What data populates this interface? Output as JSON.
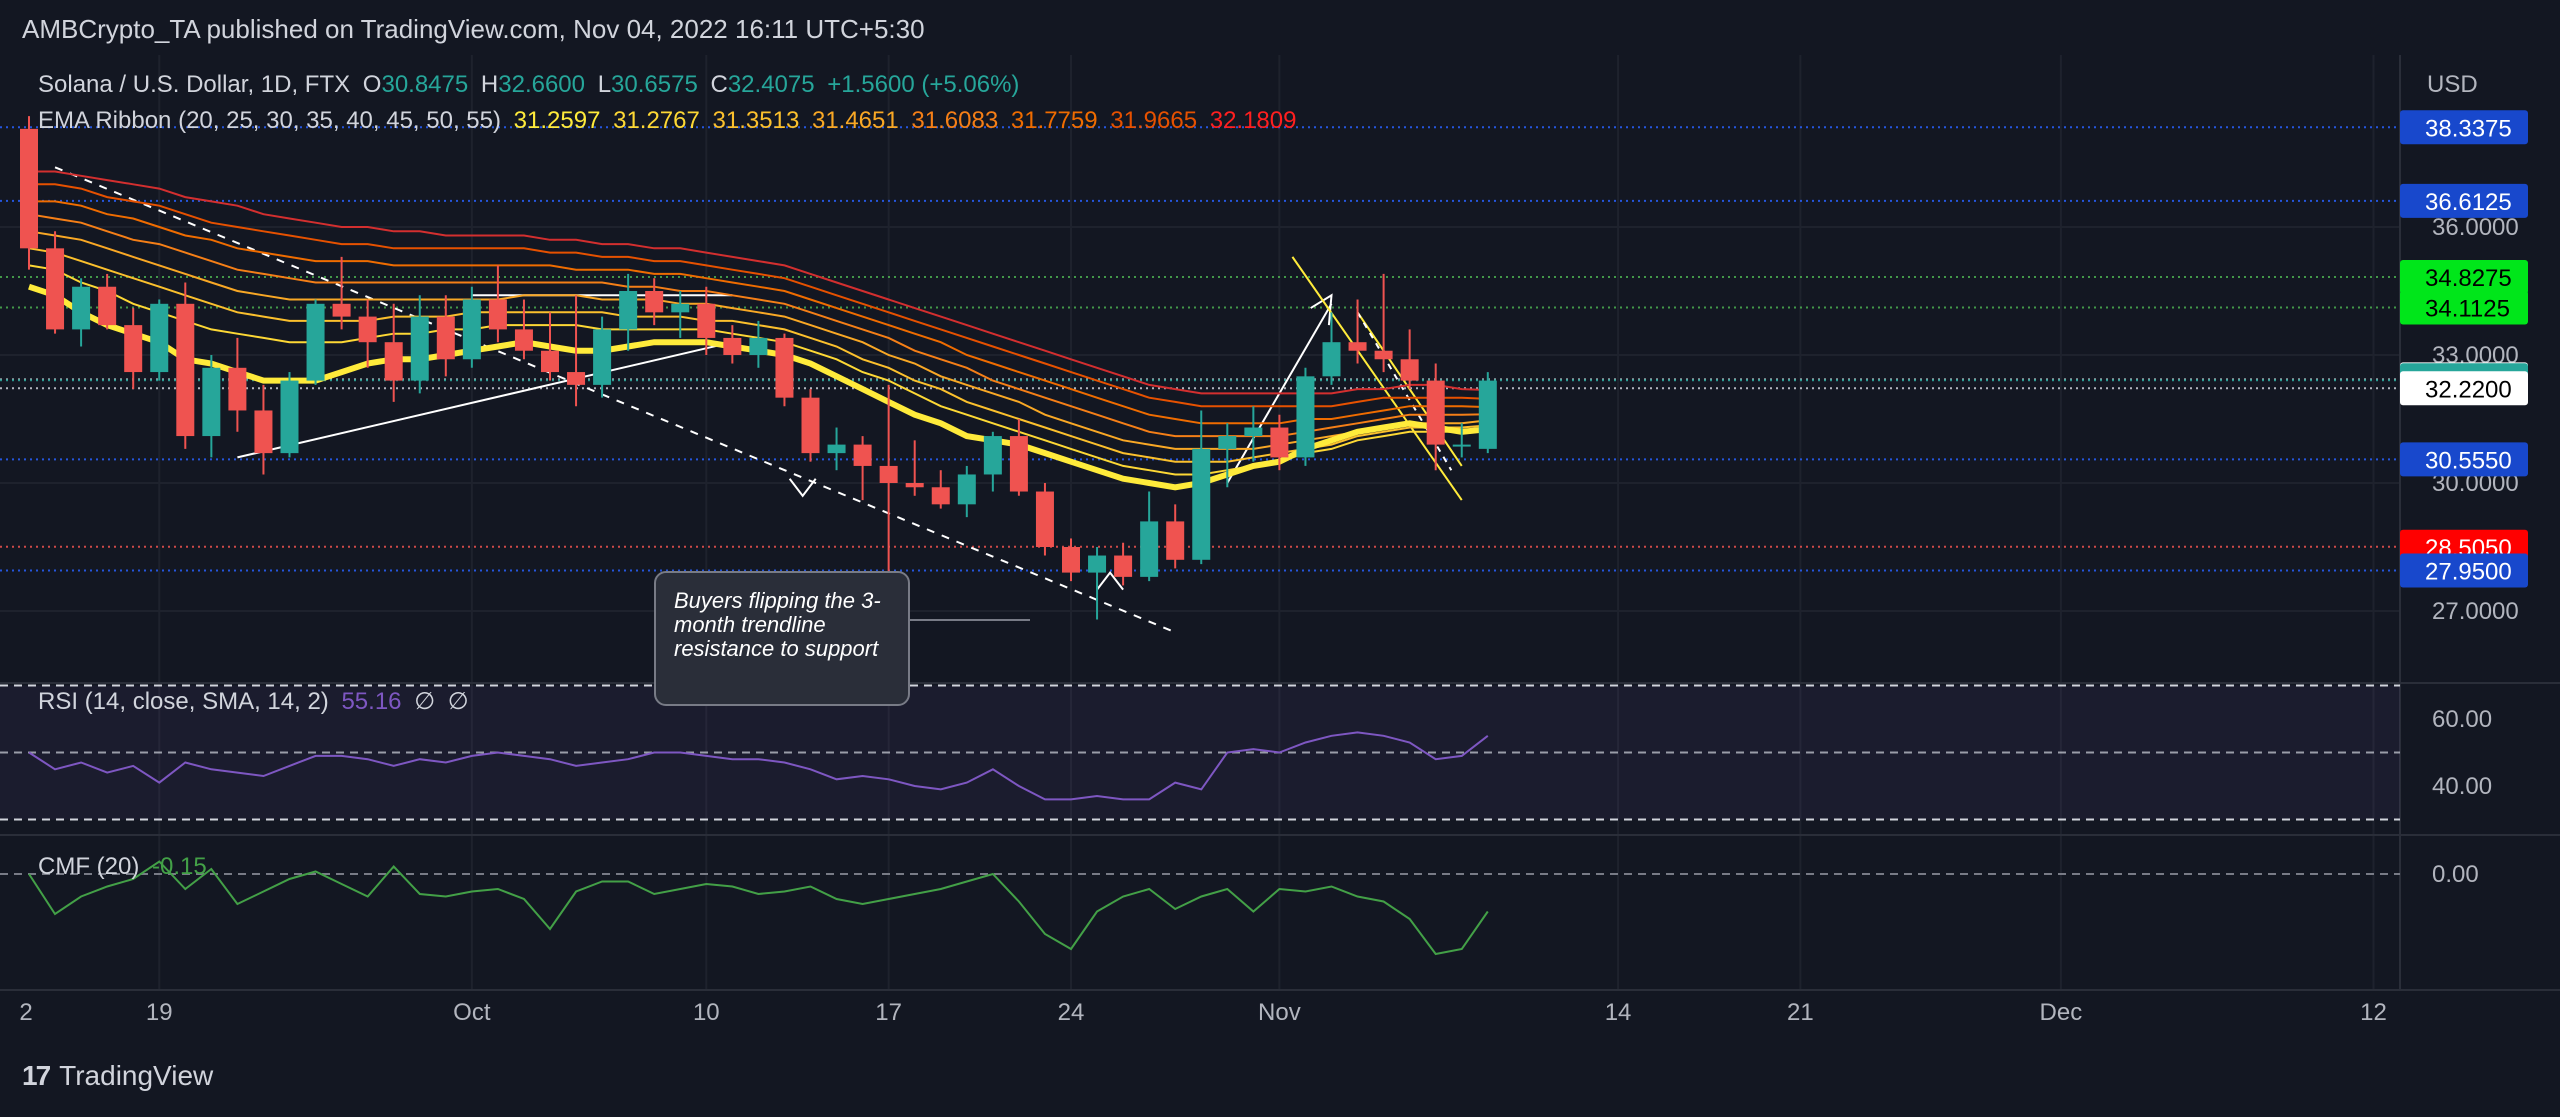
{
  "header": {
    "publisher_line": "AMBCrypto_TA published on TradingView.com, Nov 04, 2022 16:11 UTC+5:30"
  },
  "footer": {
    "brand": "TradingView",
    "logo": "17"
  },
  "legend": {
    "symbol": "Solana / U.S. Dollar, 1D, FTX",
    "o_label": "O",
    "o": "30.8475",
    "h_label": "H",
    "h": "32.6600",
    "l_label": "L",
    "l": "30.6575",
    "c_label": "C",
    "c": "32.4075",
    "change": "+1.5600 (+5.06%)",
    "ema_title": "EMA Ribbon (20, 25, 30, 35, 40, 45, 50, 55)",
    "ema_values": [
      "31.2597",
      "31.2767",
      "31.3513",
      "31.4651",
      "31.6083",
      "31.7759",
      "31.9665",
      "32.1809"
    ],
    "rsi_title": "RSI (14, close, SMA, 14, 2)",
    "rsi_value": "55.16",
    "rsi_extra1": "∅",
    "rsi_extra2": "∅",
    "cmf_title": "CMF (20)",
    "cmf_value": "-0.15"
  },
  "annotation": {
    "text": "Buyers flipping the 3-month trendline resistance to support"
  },
  "colors": {
    "up": "#26a69a",
    "down": "#ef5350",
    "ema": [
      "#ffeb3b",
      "#fdd835",
      "#fbc02d",
      "#f9a825",
      "#f57f17",
      "#ef6c00",
      "#e65100",
      "#d32f2f"
    ],
    "rsi": "#7e57c2",
    "cmf": "#43a047"
  },
  "chart_data": {
    "type": "candlestick",
    "price_axis": {
      "currency": "USD",
      "ticks": [
        "36.0000",
        "33.0000",
        "30.0000",
        "27.0000"
      ],
      "tick_values": [
        36,
        33,
        30,
        27
      ]
    },
    "x_axis": {
      "tick_labels": [
        "2",
        "19",
        "Oct",
        "10",
        "17",
        "24",
        "Nov",
        "14",
        "21",
        "Dec",
        "12"
      ],
      "tick_day_index": [
        -12,
        5,
        17,
        26,
        33,
        40,
        48,
        61,
        68,
        78,
        90
      ]
    },
    "horizontal_levels": [
      {
        "label": "38.3375",
        "value": 38.3375,
        "color": "#1848cc",
        "text_color": "#ffffff",
        "line": "#2962ff"
      },
      {
        "label": "36.6125",
        "value": 36.6125,
        "color": "#1848cc",
        "text_color": "#ffffff",
        "line": "#2962ff"
      },
      {
        "label": "34.8275",
        "value": 34.8275,
        "color": "#00e61a",
        "text_color": "#000000",
        "line": "#4caf50"
      },
      {
        "label": "34.1125",
        "value": 34.1125,
        "color": "#00e61a",
        "text_color": "#000000",
        "line": "#4caf50"
      },
      {
        "label": "32.4275",
        "value": 32.4275,
        "color": "#ffffff",
        "text_color": "#000000",
        "line": "#d1d4dc"
      },
      {
        "label": "32.4075",
        "value": 32.4075,
        "color": "#26a69a",
        "text_color": "#ffffff",
        "line": "#26a69a"
      },
      {
        "label": "32.2200",
        "value": 32.22,
        "color": "#ffffff",
        "text_color": "#000000",
        "line": "#d1d4dc"
      },
      {
        "label": "30.5550",
        "value": 30.555,
        "color": "#1848cc",
        "text_color": "#ffffff",
        "line": "#2962ff"
      },
      {
        "label": "28.5050",
        "value": 28.505,
        "color": "#ff0000",
        "text_color": "#ffffff",
        "line": "#ef5350"
      },
      {
        "label": "27.9500",
        "value": 27.95,
        "color": "#1848cc",
        "text_color": "#ffffff",
        "line": "#2962ff"
      }
    ],
    "candles": [
      [
        38.3,
        38.6,
        35.0,
        35.5
      ],
      [
        35.5,
        35.9,
        33.5,
        33.6
      ],
      [
        33.6,
        34.8,
        33.2,
        34.6
      ],
      [
        34.6,
        34.9,
        33.6,
        33.7
      ],
      [
        33.7,
        34.1,
        32.2,
        32.6
      ],
      [
        32.6,
        34.3,
        32.4,
        34.2
      ],
      [
        34.2,
        34.7,
        30.8,
        31.1
      ],
      [
        31.1,
        33.0,
        30.6,
        32.7
      ],
      [
        32.7,
        33.4,
        31.2,
        31.7
      ],
      [
        31.7,
        32.3,
        30.2,
        30.7
      ],
      [
        30.7,
        32.6,
        30.6,
        32.4
      ],
      [
        32.4,
        34.3,
        32.3,
        34.2
      ],
      [
        34.2,
        35.3,
        33.6,
        33.9
      ],
      [
        33.9,
        34.3,
        32.7,
        33.3
      ],
      [
        33.3,
        34.2,
        31.9,
        32.4
      ],
      [
        32.4,
        34.4,
        32.1,
        33.9
      ],
      [
        33.9,
        34.4,
        32.5,
        32.9
      ],
      [
        32.9,
        34.6,
        32.7,
        34.3
      ],
      [
        34.3,
        35.1,
        33.3,
        33.6
      ],
      [
        33.6,
        34.3,
        32.9,
        33.1
      ],
      [
        33.1,
        34.0,
        32.4,
        32.6
      ],
      [
        32.6,
        34.4,
        31.8,
        32.3
      ],
      [
        32.3,
        33.9,
        32.0,
        33.6
      ],
      [
        33.6,
        34.9,
        33.1,
        34.5
      ],
      [
        34.5,
        34.8,
        33.7,
        34.0
      ],
      [
        34.0,
        34.5,
        33.4,
        34.2
      ],
      [
        34.2,
        34.6,
        33.0,
        33.4
      ],
      [
        33.4,
        33.7,
        32.8,
        33.0
      ],
      [
        33.0,
        33.8,
        32.7,
        33.4
      ],
      [
        33.4,
        33.5,
        31.8,
        32.0
      ],
      [
        32.0,
        32.2,
        30.5,
        30.7
      ],
      [
        30.7,
        31.3,
        30.3,
        30.9
      ],
      [
        30.9,
        31.1,
        29.6,
        30.4
      ],
      [
        30.4,
        32.3,
        27.4,
        30.0
      ],
      [
        30.0,
        31.0,
        29.7,
        29.9
      ],
      [
        29.9,
        30.3,
        29.4,
        29.5
      ],
      [
        29.5,
        30.4,
        29.2,
        30.2
      ],
      [
        30.2,
        31.2,
        29.8,
        31.1
      ],
      [
        31.1,
        31.5,
        29.7,
        29.8
      ],
      [
        29.8,
        30.0,
        28.3,
        28.5
      ],
      [
        28.5,
        28.7,
        27.7,
        27.9
      ],
      [
        27.9,
        28.5,
        26.8,
        28.3
      ],
      [
        28.3,
        28.6,
        27.6,
        27.8
      ],
      [
        27.8,
        29.8,
        27.7,
        29.1
      ],
      [
        29.1,
        29.5,
        28.0,
        28.2
      ],
      [
        28.2,
        31.7,
        28.1,
        30.8
      ],
      [
        30.8,
        31.4,
        29.9,
        31.1
      ],
      [
        31.1,
        31.8,
        30.5,
        31.3
      ],
      [
        31.3,
        31.6,
        30.3,
        30.6
      ],
      [
        30.6,
        32.7,
        30.4,
        32.5
      ],
      [
        32.5,
        34.0,
        32.3,
        33.3
      ],
      [
        33.3,
        34.3,
        32.8,
        33.1
      ],
      [
        33.1,
        34.9,
        32.6,
        32.9
      ],
      [
        32.9,
        33.6,
        32.2,
        32.4
      ],
      [
        32.4,
        32.8,
        30.3,
        30.9
      ],
      [
        30.9,
        31.4,
        30.6,
        30.9
      ],
      [
        30.8,
        32.6,
        30.7,
        32.4
      ]
    ],
    "ema_ribbon": [
      [
        34.6,
        34.4,
        34.0,
        33.7,
        33.5,
        33.3,
        32.9,
        32.8,
        32.6,
        32.4,
        32.4,
        32.4,
        32.6,
        32.8,
        32.9,
        32.9,
        33.0,
        33.1,
        33.2,
        33.3,
        33.2,
        33.1,
        33.1,
        33.2,
        33.3,
        33.3,
        33.3,
        33.2,
        33.1,
        33.0,
        32.8,
        32.5,
        32.2,
        31.9,
        31.6,
        31.4,
        31.1,
        31.0,
        30.9,
        30.7,
        30.5,
        30.3,
        30.1,
        30.0,
        29.9,
        30.0,
        30.2,
        30.4,
        30.5,
        30.8,
        31.0,
        31.2,
        31.3,
        31.4,
        31.3,
        31.2,
        31.26
      ],
      [
        35.1,
        35.0,
        34.7,
        34.5,
        34.2,
        34.0,
        33.8,
        33.6,
        33.5,
        33.4,
        33.3,
        33.3,
        33.3,
        33.4,
        33.5,
        33.5,
        33.6,
        33.6,
        33.7,
        33.7,
        33.7,
        33.7,
        33.6,
        33.6,
        33.6,
        33.6,
        33.6,
        33.5,
        33.4,
        33.3,
        33.1,
        32.9,
        32.6,
        32.4,
        32.1,
        31.8,
        31.6,
        31.4,
        31.2,
        31.0,
        30.8,
        30.6,
        30.4,
        30.3,
        30.2,
        30.2,
        30.3,
        30.4,
        30.5,
        30.7,
        30.8,
        31.0,
        31.1,
        31.2,
        31.2,
        31.2,
        31.28
      ],
      [
        35.5,
        35.4,
        35.2,
        35.0,
        34.8,
        34.6,
        34.4,
        34.2,
        34.0,
        33.9,
        33.8,
        33.8,
        33.8,
        33.8,
        33.9,
        33.9,
        33.9,
        34.0,
        34.0,
        34.0,
        34.0,
        34.0,
        34.0,
        33.9,
        33.9,
        33.9,
        33.8,
        33.8,
        33.7,
        33.6,
        33.4,
        33.2,
        32.9,
        32.7,
        32.4,
        32.2,
        31.9,
        31.7,
        31.5,
        31.3,
        31.1,
        30.9,
        30.7,
        30.6,
        30.5,
        30.5,
        30.5,
        30.6,
        30.7,
        30.8,
        30.9,
        31.1,
        31.2,
        31.3,
        31.3,
        31.3,
        31.35
      ],
      [
        35.9,
        35.8,
        35.7,
        35.5,
        35.3,
        35.1,
        34.9,
        34.7,
        34.5,
        34.4,
        34.3,
        34.3,
        34.3,
        34.3,
        34.3,
        34.3,
        34.3,
        34.3,
        34.3,
        34.4,
        34.4,
        34.4,
        34.3,
        34.3,
        34.3,
        34.2,
        34.2,
        34.1,
        34.0,
        33.9,
        33.7,
        33.5,
        33.3,
        33.0,
        32.8,
        32.5,
        32.3,
        32.1,
        31.9,
        31.6,
        31.4,
        31.2,
        31.0,
        30.9,
        30.8,
        30.8,
        30.8,
        30.8,
        30.9,
        31.0,
        31.1,
        31.2,
        31.3,
        31.4,
        31.4,
        31.4,
        31.47
      ],
      [
        36.3,
        36.2,
        36.1,
        35.9,
        35.7,
        35.6,
        35.4,
        35.2,
        35.0,
        34.9,
        34.8,
        34.7,
        34.7,
        34.7,
        34.7,
        34.7,
        34.7,
        34.7,
        34.7,
        34.7,
        34.7,
        34.7,
        34.7,
        34.6,
        34.6,
        34.5,
        34.5,
        34.4,
        34.3,
        34.2,
        34.0,
        33.8,
        33.6,
        33.4,
        33.1,
        32.9,
        32.7,
        32.4,
        32.2,
        32.0,
        31.8,
        31.6,
        31.4,
        31.2,
        31.1,
        31.1,
        31.1,
        31.1,
        31.1,
        31.2,
        31.3,
        31.4,
        31.5,
        31.6,
        31.6,
        31.6,
        31.61
      ],
      [
        36.6,
        36.6,
        36.5,
        36.3,
        36.2,
        36.0,
        35.8,
        35.7,
        35.5,
        35.4,
        35.3,
        35.2,
        35.2,
        35.2,
        35.1,
        35.1,
        35.1,
        35.1,
        35.1,
        35.1,
        35.1,
        35.0,
        35.0,
        35.0,
        34.9,
        34.9,
        34.8,
        34.7,
        34.6,
        34.5,
        34.3,
        34.1,
        33.9,
        33.7,
        33.5,
        33.3,
        33.0,
        32.8,
        32.6,
        32.4,
        32.2,
        32.0,
        31.8,
        31.6,
        31.5,
        31.4,
        31.4,
        31.4,
        31.4,
        31.5,
        31.5,
        31.6,
        31.7,
        31.8,
        31.8,
        31.8,
        31.78
      ],
      [
        37.0,
        37.0,
        36.9,
        36.7,
        36.6,
        36.5,
        36.3,
        36.1,
        36.0,
        35.9,
        35.8,
        35.7,
        35.6,
        35.6,
        35.5,
        35.5,
        35.5,
        35.5,
        35.5,
        35.5,
        35.4,
        35.4,
        35.3,
        35.3,
        35.2,
        35.2,
        35.1,
        35.0,
        34.9,
        34.8,
        34.6,
        34.4,
        34.2,
        34.0,
        33.8,
        33.6,
        33.4,
        33.2,
        33.0,
        32.8,
        32.6,
        32.4,
        32.2,
        32.0,
        31.9,
        31.8,
        31.8,
        31.8,
        31.8,
        31.8,
        31.8,
        31.9,
        32.0,
        32.0,
        32.0,
        32.0,
        31.97
      ],
      [
        37.3,
        37.3,
        37.2,
        37.1,
        37.0,
        36.9,
        36.7,
        36.6,
        36.5,
        36.3,
        36.2,
        36.1,
        36.0,
        36.0,
        35.9,
        35.9,
        35.8,
        35.8,
        35.8,
        35.8,
        35.7,
        35.7,
        35.6,
        35.6,
        35.5,
        35.5,
        35.4,
        35.3,
        35.2,
        35.1,
        34.9,
        34.7,
        34.5,
        34.3,
        34.1,
        33.9,
        33.7,
        33.5,
        33.3,
        33.1,
        32.9,
        32.7,
        32.5,
        32.3,
        32.2,
        32.1,
        32.1,
        32.1,
        32.1,
        32.1,
        32.1,
        32.2,
        32.2,
        32.3,
        32.3,
        32.2,
        32.18
      ]
    ],
    "rsi": {
      "ticks": [
        "60.00",
        "40.00"
      ],
      "tick_values": [
        60,
        40
      ],
      "values": [
        50,
        45,
        47,
        44,
        46,
        41,
        47,
        45,
        44,
        43,
        46,
        49,
        49,
        48,
        46,
        48,
        47,
        49,
        50,
        49,
        48,
        46,
        47,
        48,
        50,
        50,
        49,
        48,
        48,
        47,
        45,
        42,
        43,
        42,
        40,
        39,
        41,
        45,
        40,
        36,
        36,
        37,
        36,
        36,
        41,
        39,
        50,
        51,
        50,
        53,
        55,
        56,
        55,
        53,
        48,
        49,
        55
      ]
    },
    "cmf": {
      "ticks": [
        "0.00"
      ],
      "tick_values": [
        0
      ],
      "values": [
        0.0,
        -0.16,
        -0.09,
        -0.05,
        -0.02,
        0.05,
        -0.06,
        0.02,
        -0.12,
        -0.07,
        -0.02,
        0.01,
        -0.04,
        -0.09,
        0.03,
        -0.08,
        -0.09,
        -0.07,
        -0.06,
        -0.1,
        -0.22,
        -0.07,
        -0.03,
        -0.03,
        -0.08,
        -0.06,
        -0.04,
        -0.05,
        -0.08,
        -0.07,
        -0.05,
        -0.1,
        -0.12,
        -0.1,
        -0.08,
        -0.06,
        -0.03,
        0.0,
        -0.11,
        -0.24,
        -0.3,
        -0.15,
        -0.09,
        -0.06,
        -0.14,
        -0.09,
        -0.06,
        -0.15,
        -0.06,
        -0.07,
        -0.05,
        -0.09,
        -0.11,
        -0.18,
        -0.32,
        -0.3,
        -0.15
      ]
    }
  }
}
